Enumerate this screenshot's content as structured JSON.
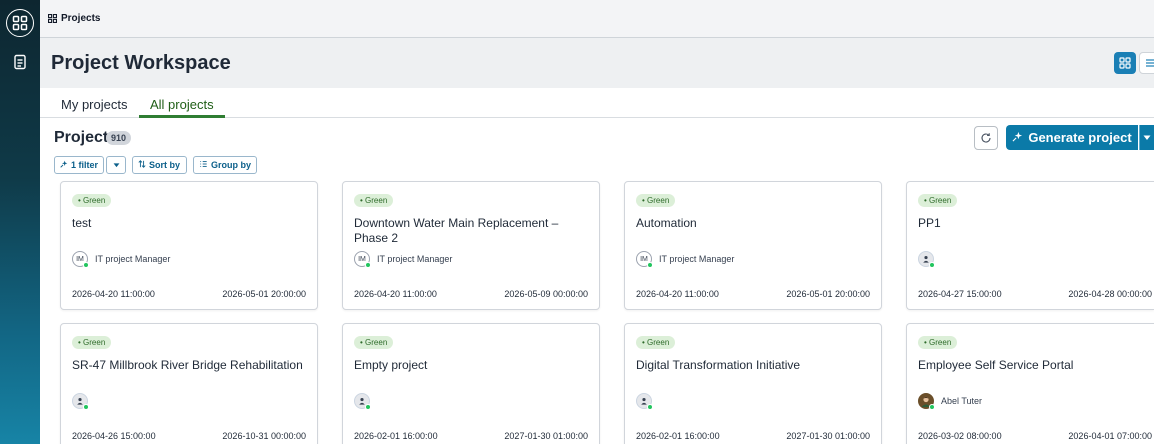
{
  "breadcrumb": {
    "label": "Projects"
  },
  "header": {
    "title": "Project Workspace"
  },
  "tabs": [
    {
      "label": "My projects",
      "active": false
    },
    {
      "label": "All projects",
      "active": true
    }
  ],
  "project_list": {
    "title": "Project",
    "count": "910",
    "generate_label": "Generate project",
    "filters": {
      "filter_label": "1 filter",
      "sort_label": "Sort by",
      "group_label": "Group by"
    }
  },
  "colors": {
    "accent": "#0b7aa8",
    "status_green_bg": "#dcefd8",
    "status_green_text": "#2e6b2a",
    "rail_dark": "#0d2630"
  },
  "cards": [
    {
      "status": "Green",
      "title": "test",
      "owner": "IT project Manager",
      "initials": "IM",
      "start": "2026-04-20 11:00:00",
      "end": "2026-05-01 20:00:00"
    },
    {
      "status": "Green",
      "title": "Downtown Water Main Replacement – Phase 2",
      "owner": "IT project Manager",
      "initials": "IM",
      "start": "2026-04-20 11:00:00",
      "end": "2026-05-09 00:00:00"
    },
    {
      "status": "Green",
      "title": "Automation",
      "owner": "IT project Manager",
      "initials": "IM",
      "start": "2026-04-20 11:00:00",
      "end": "2026-05-01 20:00:00"
    },
    {
      "status": "Green",
      "title": "PP1",
      "owner": "",
      "initials": "",
      "start": "2026-04-27 15:00:00",
      "end": "2026-04-28 00:00:00"
    },
    {
      "status": "Green",
      "title": "SR-47 Millbrook River Bridge Rehabilitation",
      "owner": "",
      "initials": "",
      "start": "2026-04-26 15:00:00",
      "end": "2026-10-31 00:00:00"
    },
    {
      "status": "Green",
      "title": "Empty project",
      "owner": "",
      "initials": "",
      "start": "2026-02-01 16:00:00",
      "end": "2027-01-30 01:00:00"
    },
    {
      "status": "Green",
      "title": "Digital Transformation Initiative",
      "owner": "",
      "initials": "",
      "start": "2026-02-01 16:00:00",
      "end": "2027-01-30 01:00:00"
    },
    {
      "status": "Green",
      "title": "Employee Self Service Portal",
      "owner": "Abel Tuter",
      "initials": "",
      "start": "2026-03-02 08:00:00",
      "end": "2026-04-01 07:00:00"
    }
  ]
}
